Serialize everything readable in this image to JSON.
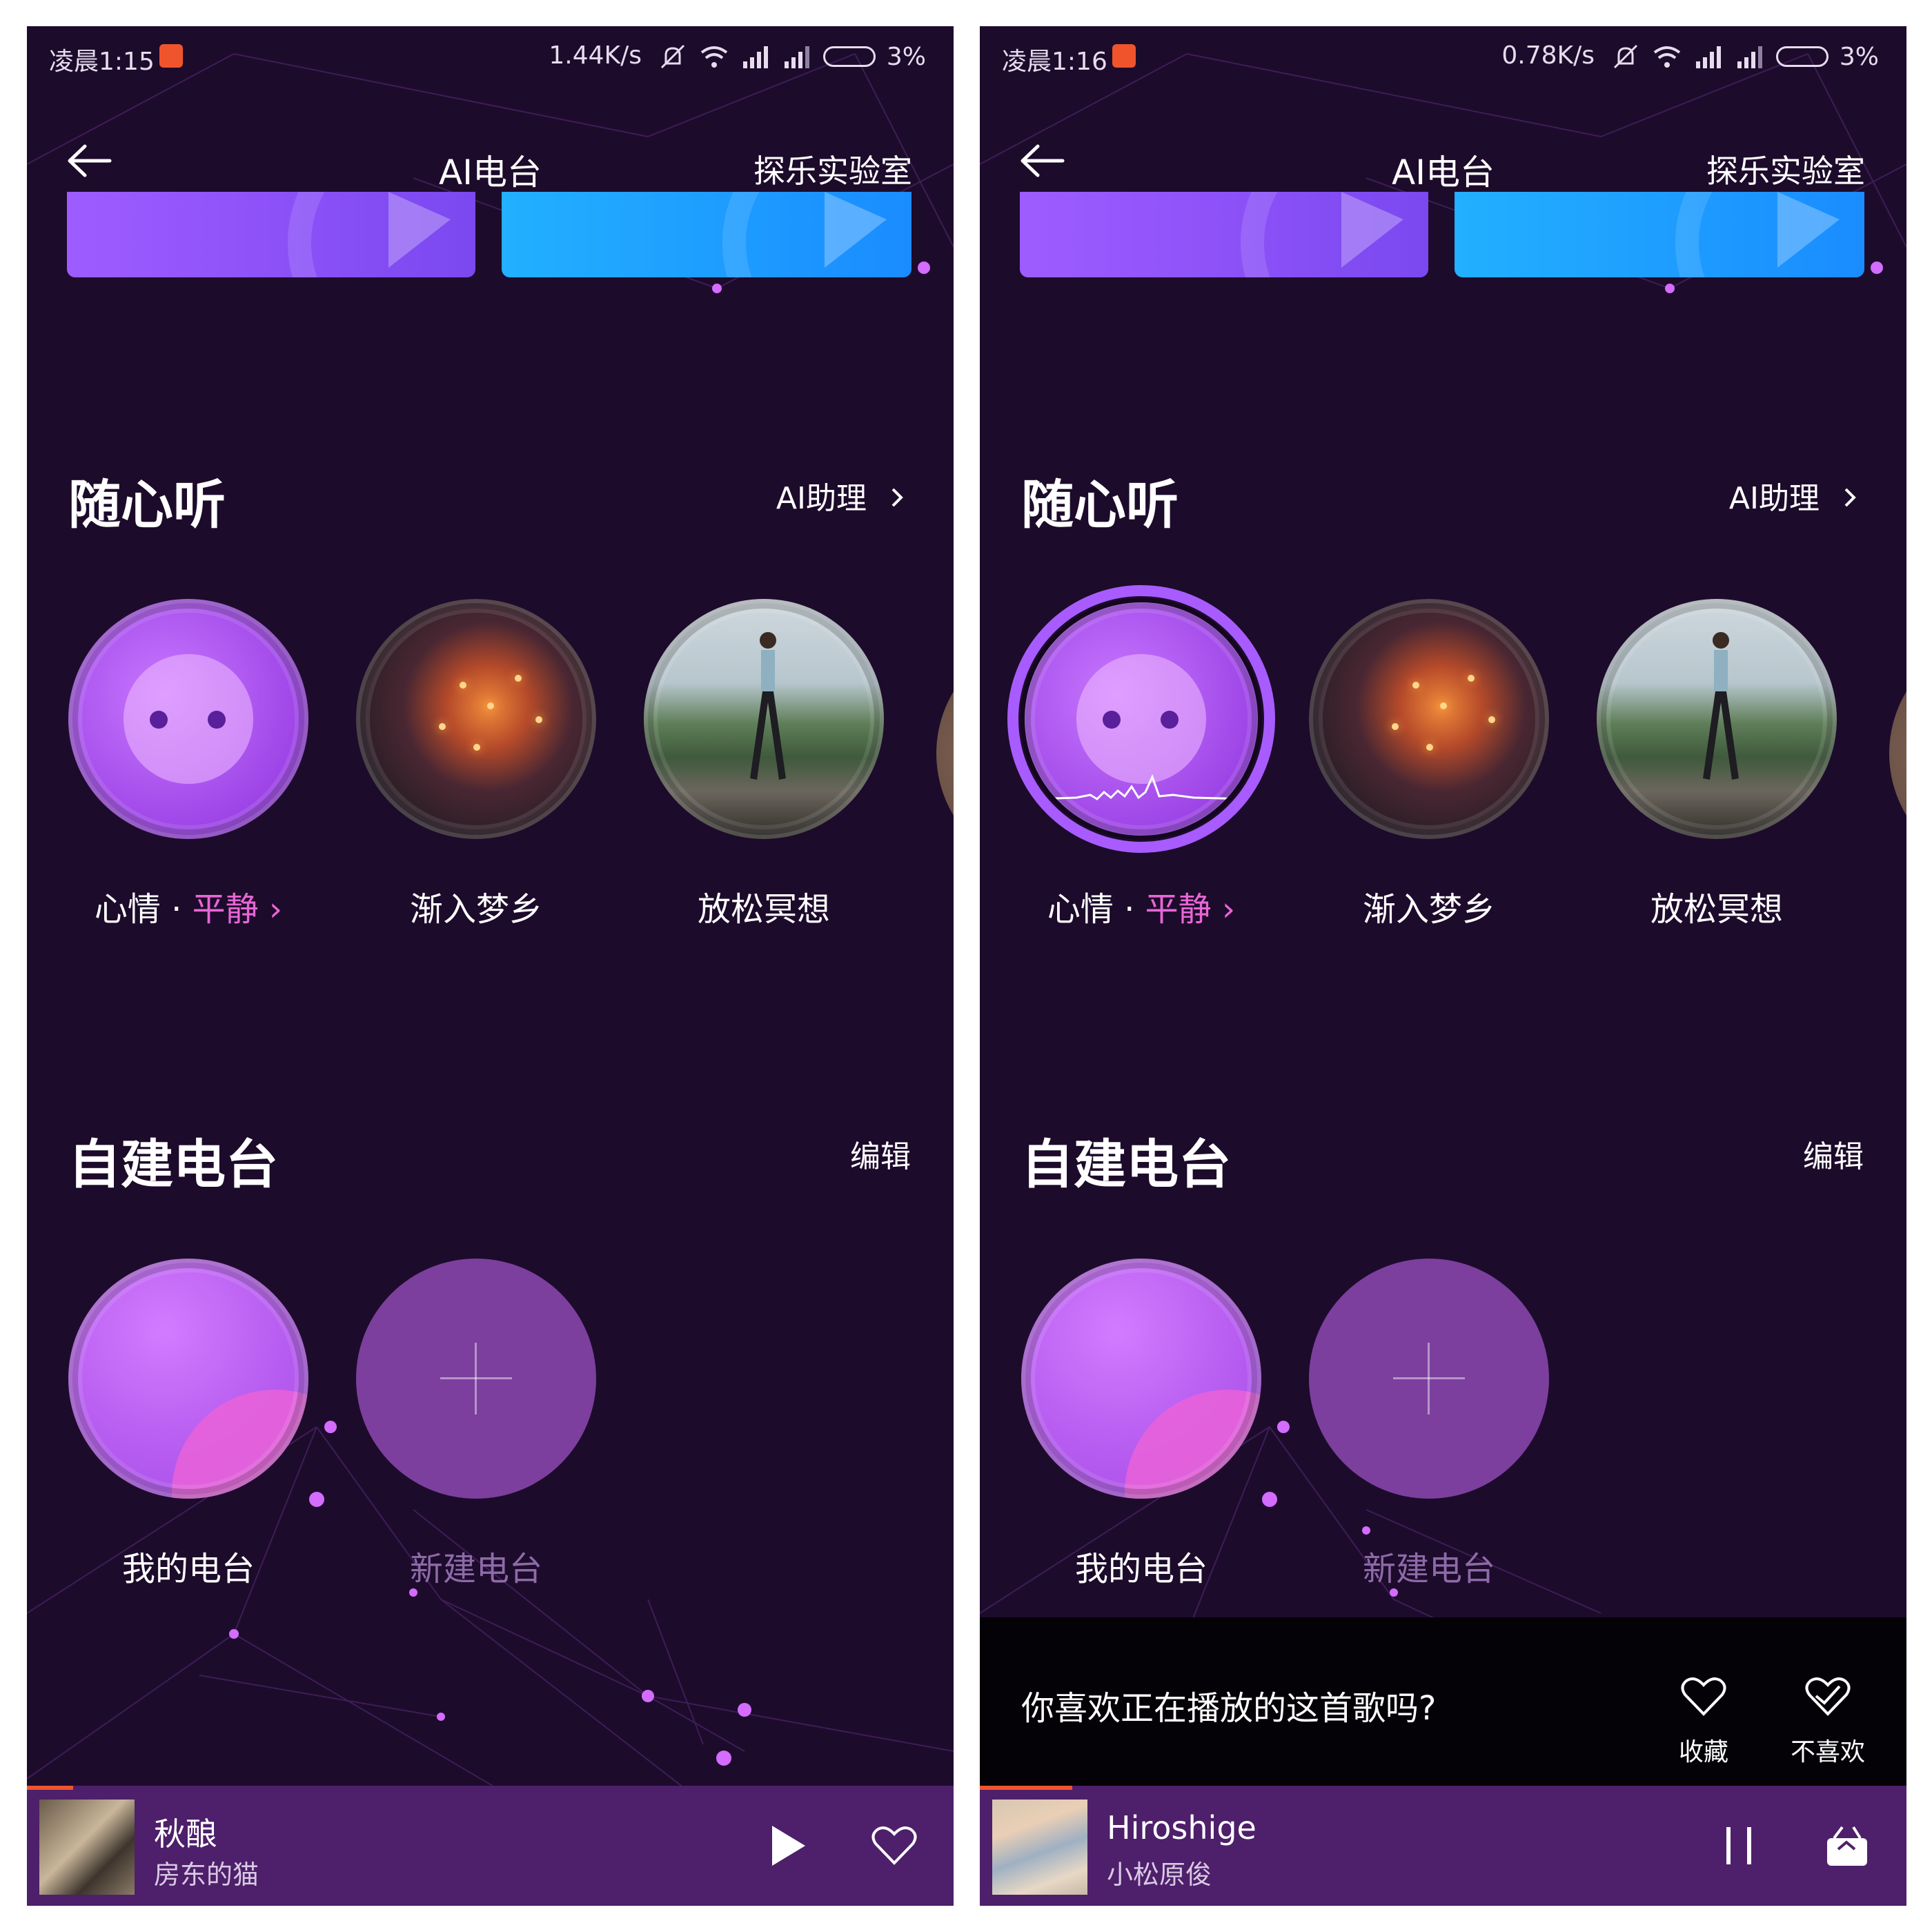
{
  "left": {
    "status": {
      "time": "凌晨1:15",
      "speed": "1.44K/s",
      "battery": "3%"
    },
    "header": {
      "title": "AI电台",
      "lab": "探乐实验室"
    },
    "casual": {
      "title": "随心听",
      "assistant": "AI助理",
      "items": [
        {
          "prefix": "心情 · ",
          "accent": "平静",
          "suffix": " ›"
        },
        {
          "label": "渐入梦乡"
        },
        {
          "label": "放松冥想"
        }
      ]
    },
    "custom": {
      "title": "自建电台",
      "edit": "编辑",
      "items": [
        {
          "label": "我的电台"
        },
        {
          "label": "新建电台"
        }
      ]
    },
    "player": {
      "track": "秋酿",
      "artist": "房东的猫",
      "progress": 0.05
    }
  },
  "right": {
    "status": {
      "time": "凌晨1:16",
      "speed": "0.78K/s",
      "battery": "3%"
    },
    "header": {
      "title": "AI电台",
      "lab": "探乐实验室"
    },
    "casual": {
      "title": "随心听",
      "assistant": "AI助理",
      "items": [
        {
          "prefix": "心情 · ",
          "accent": "平静",
          "suffix": " ›"
        },
        {
          "label": "渐入梦乡"
        },
        {
          "label": "放松冥想"
        }
      ]
    },
    "custom": {
      "title": "自建电台",
      "edit": "编辑",
      "items": [
        {
          "label": "我的电台"
        },
        {
          "label": "新建电台"
        }
      ]
    },
    "feedback": {
      "question": "你喜欢正在播放的这首歌吗?",
      "collect": "收藏",
      "dislike": "不喜欢"
    },
    "player": {
      "track": "Hiroshige",
      "artist": "小松原俊",
      "progress": 0.1
    }
  },
  "colors": {
    "background": "#1d0b2b",
    "player": "#4e1f6a",
    "accent": "#e866d6",
    "progress": "#f0542d"
  },
  "icons": [
    "back-arrow-icon",
    "wifi-icon",
    "signal-icon",
    "battery-icon",
    "mute-icon",
    "play-icon",
    "pause-icon",
    "heart-icon",
    "dislike-heart-icon",
    "radio-icon",
    "plus-icon",
    "chevron-right-icon"
  ]
}
